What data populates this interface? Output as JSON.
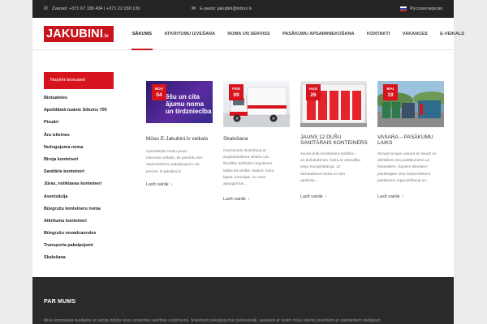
{
  "topbar": {
    "phone": "Zvaniet: +371 67 186 434 | +371 22 030 130",
    "email": "E-pasts: jakubini@inbox.lv",
    "language": "Русская версия"
  },
  "header": {
    "logo_text": "JAKUBINI",
    "logo_suffix": ".lv",
    "nav": [
      {
        "label": "SĀKUMS",
        "active": true
      },
      {
        "label": "ATKRITUMU IZVEŠANA"
      },
      {
        "label": "NOMA UN SERVISS"
      },
      {
        "label": "PASĀKUMU APSAIMNIEKOŠANA"
      },
      {
        "label": "KONTAKTI"
      },
      {
        "label": "VAKANCES"
      },
      {
        "label": "E-VEIKALS"
      }
    ]
  },
  "sidebar": {
    "button_label": "Nopirkt biotualeti",
    "categories": [
      "Biotualetes",
      "Apsildāmā tualete Siltums 700",
      "Pisuāri",
      "Āra izlietnes",
      "Nožogojuma noma",
      "Biroja konteineri",
      "Sanitārie konteineri",
      "Jūras, noliktavas konteineri",
      "Asenizācija",
      "Būvgružu konteineru noma",
      "Atkritumu konteineri",
      "Būvgružu novadcaurules",
      "Transporta pakalpojumi",
      "Skalošana"
    ]
  },
  "posts": [
    {
      "month": "NOV",
      "day": "04",
      "thumb_text": "ēšu un cita ājumu noma un tirdzniecība",
      "title": "Mūsu E-Jakubini.lv veikals",
      "text": [
        "Apmeklējiet mūsu jauno",
        "interneta veikalu, lai pasūtītu sev",
        "nepieciešamo pakalpojumu vai",
        "preces. E-jakubini.lv"
      ],
      "more": "Lasīt vairāk"
    },
    {
      "month": "FEB",
      "day": "09",
      "title": "Skalošana",
      "text": [
        "Caurulvadu skalošana ar",
        "augstspiediena iekārtu Lai",
        "likvidētu dažādus nogulsnes,",
        "tādas kā smiltis, taukus, koku",
        "lapas, korozijas, un citus",
        "apaugumus..."
      ],
      "more": "Lasīt vairāk"
    },
    {
      "month": "AUG",
      "day": "26",
      "title_lines": [
        "JAUNS 12 DUŠU",
        "SANITĀRAIS KONTEINERS"
      ],
      "text": [
        "Jauna dušu konteinera īpašība –",
        "12 dušukabīnes, katra ar atsevišķu",
        "ieeju Komplektācija: 12",
        "dušukabīnes katra no tām",
        "aprīkota..."
      ],
      "more": "Lasīt vairāk"
    },
    {
      "month": "MAI",
      "day": "19",
      "title_lines": [
        "VASARA – PASĀKUMU",
        "LAIKS"
      ],
      "text": [
        "Straujī tuvojas vasara ar daudz un",
        "dažādiem āra pasākumiem un",
        "festivāliem. Saviem klientiem",
        "piedāvājam visu nepieciešamo",
        "pasākumu organizēšanai un..."
      ],
      "more": "Lasīt vairāk"
    }
  ],
  "footer": {
    "heading": "PAR MUMS",
    "text": "Mūsu kompānija kvalitatīvi un laicīgi izpilda visas uzņemtās saistības uzņēmumā. Sniedzam pakalpojumus profesionāli, saskaņot ar visām mūsu klientu prasībām un standartiem pielāgojot."
  }
}
